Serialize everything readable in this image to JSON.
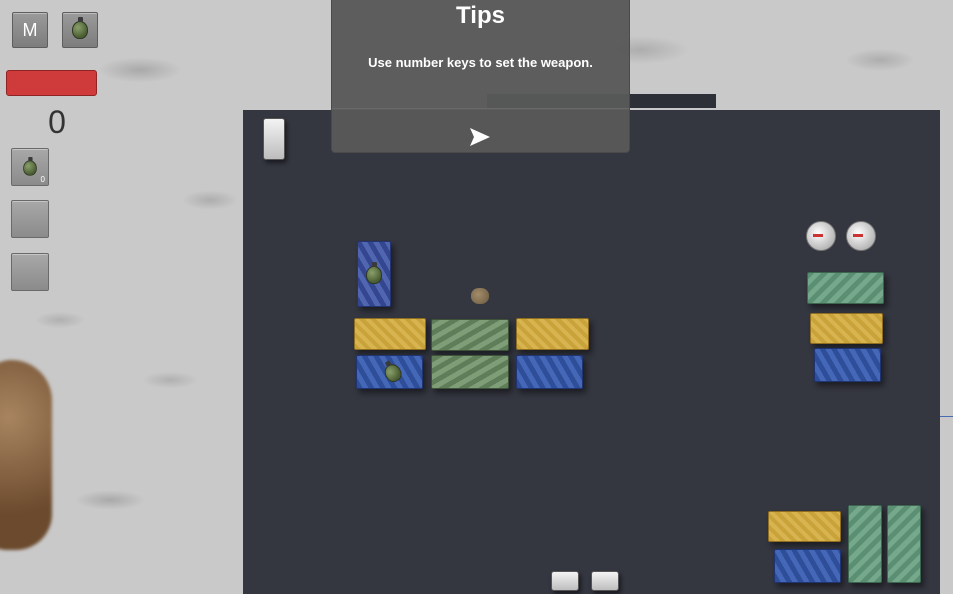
{
  "hud": {
    "menu_label": "M",
    "score": "0",
    "health_percent": 100,
    "weapon_slots": [
      {
        "icon": "grenade-icon",
        "count": "0"
      },
      {
        "icon": "empty-slot",
        "count": ""
      },
      {
        "icon": "empty-slot",
        "count": ""
      }
    ]
  },
  "tips": {
    "title": "Tips",
    "message": "Use number keys to set the weapon."
  },
  "colors": {
    "health": "#cf3b3b",
    "map_floor": "#343640",
    "panel": "#585858"
  }
}
